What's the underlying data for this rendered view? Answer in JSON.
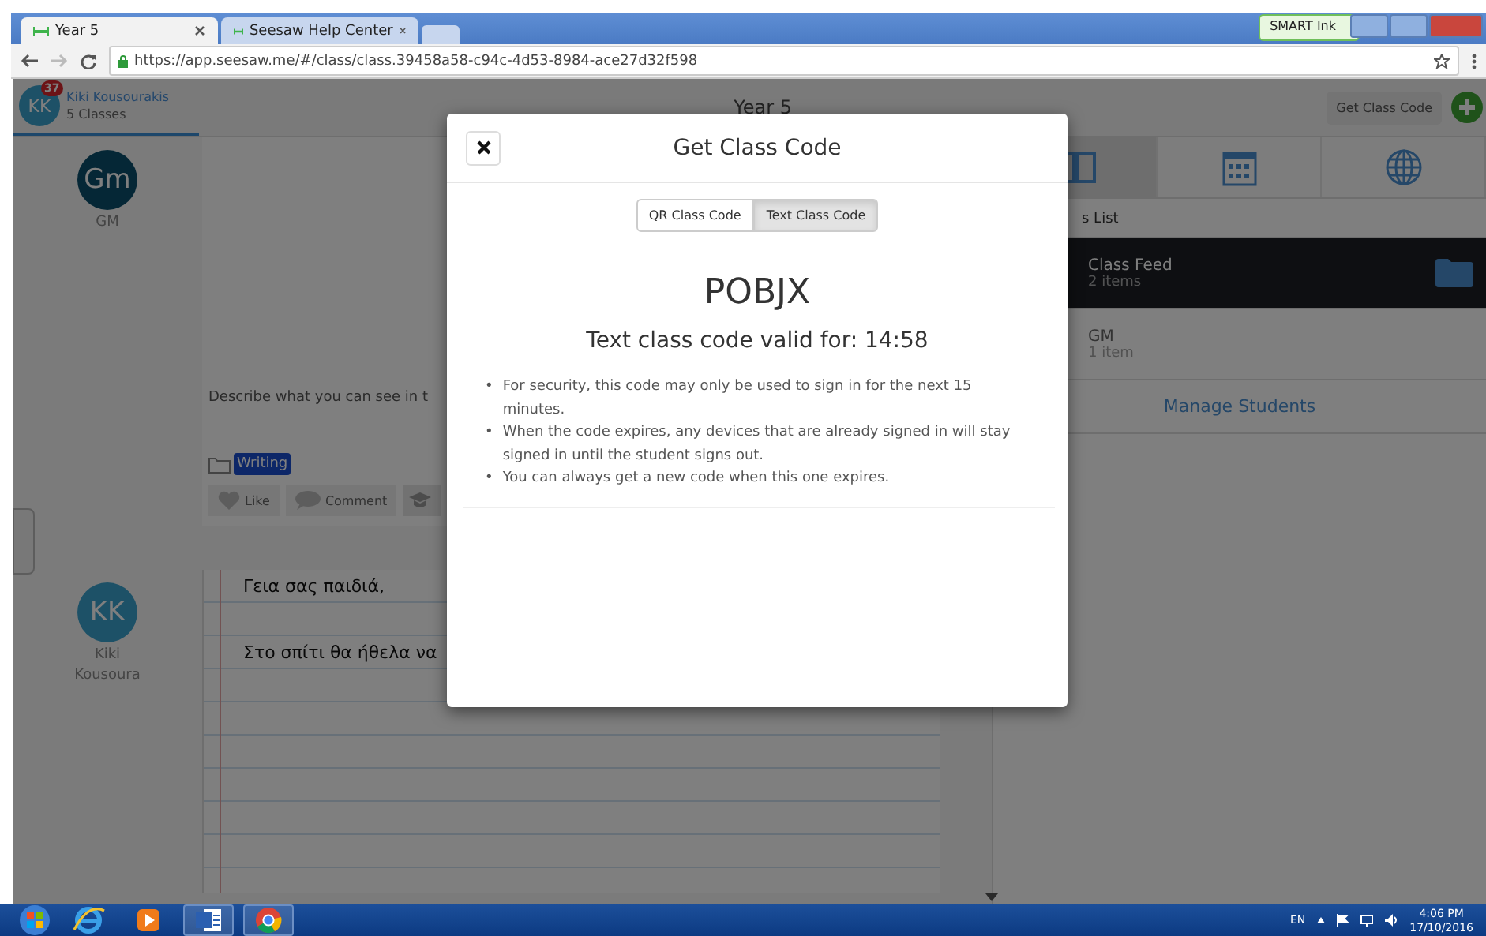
{
  "browser": {
    "tabs": [
      {
        "title": "Year 5",
        "selected": true
      },
      {
        "title": "Seesaw Help Center",
        "selected": false
      }
    ],
    "smart_ink": "SMART Ink",
    "url": "https://app.seesaw.me/#/class/class.39458a58-c94c-4d53-8984-ace27d32f598"
  },
  "header": {
    "user": {
      "initials": "KK",
      "badge": "37",
      "name": "Kiki Kousourakis",
      "subtitle": "5 Classes"
    },
    "title": "Year 5",
    "get_code_button": "Get Class Code"
  },
  "feed": [
    {
      "kind": "photo",
      "author": {
        "initials": "Gm",
        "name": "GM"
      },
      "caption": "Describe what you can see in t",
      "folder": "Writing",
      "actions": [
        "Like",
        "Comment"
      ]
    },
    {
      "kind": "note",
      "author": {
        "initials": "KK",
        "name": "Kiki Kousoura"
      },
      "lines": [
        "Γεια σας παιδιά,",
        "Στο σπίτι θα ήθελα να"
      ]
    }
  ],
  "sidebar": {
    "view_tabs": [
      {
        "kind": "journal",
        "selected": true
      },
      {
        "kind": "calendar",
        "selected": false
      },
      {
        "kind": "globe",
        "selected": false
      }
    ],
    "list_title": "s List",
    "items": [
      {
        "name": "Class Feed",
        "count": "2 items",
        "selected": true
      },
      {
        "name": "GM",
        "count": "1 item",
        "selected": false
      }
    ],
    "manage": "Manage Students"
  },
  "modal": {
    "title": "Get Class Code",
    "toggle": [
      {
        "label": "QR Class Code",
        "selected": false
      },
      {
        "label": "Text Class Code",
        "selected": true
      }
    ],
    "code": "POBJX",
    "validity": "Text class code valid for: 14:58",
    "notes": [
      {
        "marker": "•",
        "text": "For security, this code may only be used to sign in for the next 15 minutes."
      },
      {
        "marker": "•",
        "text": "When the code expires, any devices that are already signed in will stay signed in until the student signs out."
      },
      {
        "marker": "•",
        "text": "You can always get a new code when this one expires."
      }
    ]
  },
  "taskbar": {
    "apps": [
      {
        "kind": "ie"
      },
      {
        "kind": "media"
      },
      {
        "kind": "word"
      },
      {
        "kind": "chrome"
      }
    ],
    "language": "EN",
    "time": "4:06 PM",
    "date": "17/10/2016"
  }
}
